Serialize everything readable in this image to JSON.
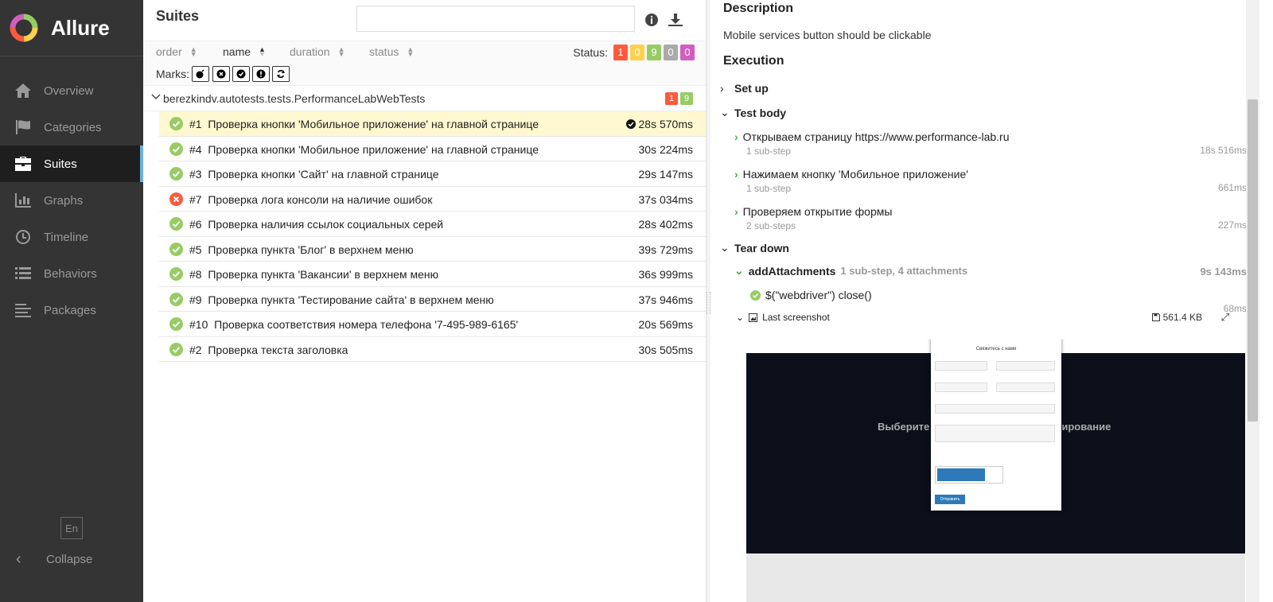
{
  "app": {
    "brand": "Allure"
  },
  "sidebar": {
    "items": [
      {
        "label": "Overview",
        "icon": "home-icon",
        "active": false
      },
      {
        "label": "Categories",
        "icon": "flag-icon",
        "active": false
      },
      {
        "label": "Suites",
        "icon": "briefcase-icon",
        "active": true
      },
      {
        "label": "Graphs",
        "icon": "bar-chart-icon",
        "active": false
      },
      {
        "label": "Timeline",
        "icon": "clock-icon",
        "active": false
      },
      {
        "label": "Behaviors",
        "icon": "list-icon",
        "active": false
      },
      {
        "label": "Packages",
        "icon": "align-left-icon",
        "active": false
      }
    ],
    "lang": "En",
    "collapse_label": "Collapse"
  },
  "suites": {
    "title": "Suites",
    "search_value": "",
    "sort": {
      "order": "order",
      "name": "name",
      "duration": "duration",
      "status": "status"
    },
    "status_label": "Status:",
    "status_counts": {
      "failed": "1",
      "broken": "0",
      "passed": "9",
      "skipped": "0",
      "unknown": "0"
    },
    "marks_label": "Marks:",
    "group": {
      "name": "berezkindv.autotests.tests.PerformanceLabWebTests",
      "failed": "1",
      "passed": "9"
    },
    "tests": [
      {
        "num": "#1",
        "title": "Проверка кнопки 'Мобильное приложение' на главной странице",
        "duration": "28s 570ms",
        "status": "passed",
        "selected": true
      },
      {
        "num": "#4",
        "title": "Проверка кнопки 'Мобильное приложение' на главной странице",
        "duration": "30s 224ms",
        "status": "passed",
        "selected": false
      },
      {
        "num": "#3",
        "title": "Проверка кнопки 'Сайт' на главной странице",
        "duration": "29s 147ms",
        "status": "passed",
        "selected": false
      },
      {
        "num": "#7",
        "title": "Проверка лога консоли на наличие ошибок",
        "duration": "37s 034ms",
        "status": "failed",
        "selected": false
      },
      {
        "num": "#6",
        "title": "Проверка наличия ссылок социальных серей",
        "duration": "28s 402ms",
        "status": "passed",
        "selected": false
      },
      {
        "num": "#5",
        "title": "Проверка пункта 'Блог' в верхнем меню",
        "duration": "39s 729ms",
        "status": "passed",
        "selected": false
      },
      {
        "num": "#8",
        "title": "Проверка пункта 'Вакансии' в верхнем меню",
        "duration": "36s 999ms",
        "status": "passed",
        "selected": false
      },
      {
        "num": "#9",
        "title": "Проверка пункта 'Тестирование сайта' в верхнем меню",
        "duration": "37s 946ms",
        "status": "passed",
        "selected": false
      },
      {
        "num": "#10",
        "title": "Проверка соответствия номера телефона '7-495-989-6165'",
        "duration": "20s 569ms",
        "status": "passed",
        "selected": false
      },
      {
        "num": "#2",
        "title": "Проверка текста заголовка",
        "duration": "30s 505ms",
        "status": "passed",
        "selected": false
      }
    ]
  },
  "detail": {
    "description_title": "Description",
    "description": "Mobile services button should be clickable",
    "execution_title": "Execution",
    "setup_label": "Set up",
    "testbody_label": "Test body",
    "teardown_label": "Tear down",
    "body_steps": [
      {
        "name": "Открываем страницу https://www.performance-lab.ru",
        "sub": "1 sub-step",
        "time": "18s 516ms"
      },
      {
        "name": "Нажимаем кнопку 'Мобильное приложение'",
        "sub": "1 sub-step",
        "time": "661ms"
      },
      {
        "name": "Проверяем открытие формы",
        "sub": "2 sub-steps",
        "time": "227ms"
      }
    ],
    "teardown_step": {
      "name": "addAttachments",
      "info": "1 sub-step, 4 attachments",
      "time": "9s 143ms"
    },
    "close_step": {
      "name": "$(\"webdriver\") close()",
      "time": "68ms"
    },
    "attachment": {
      "name": "Last screenshot",
      "size": "561.4 KB"
    },
    "screenshot": {
      "hero_left": "Выберите",
      "hero_right": "тирование",
      "modal_title": "Свяжитесь с нами",
      "submit": "Отправить"
    }
  },
  "colors": {
    "failed": "#fd5a3e",
    "broken": "#ffd050",
    "passed": "#97cc64",
    "skipped": "#aaaaaa",
    "unknown": "#d35ebe",
    "accent": "#6ab0de"
  }
}
